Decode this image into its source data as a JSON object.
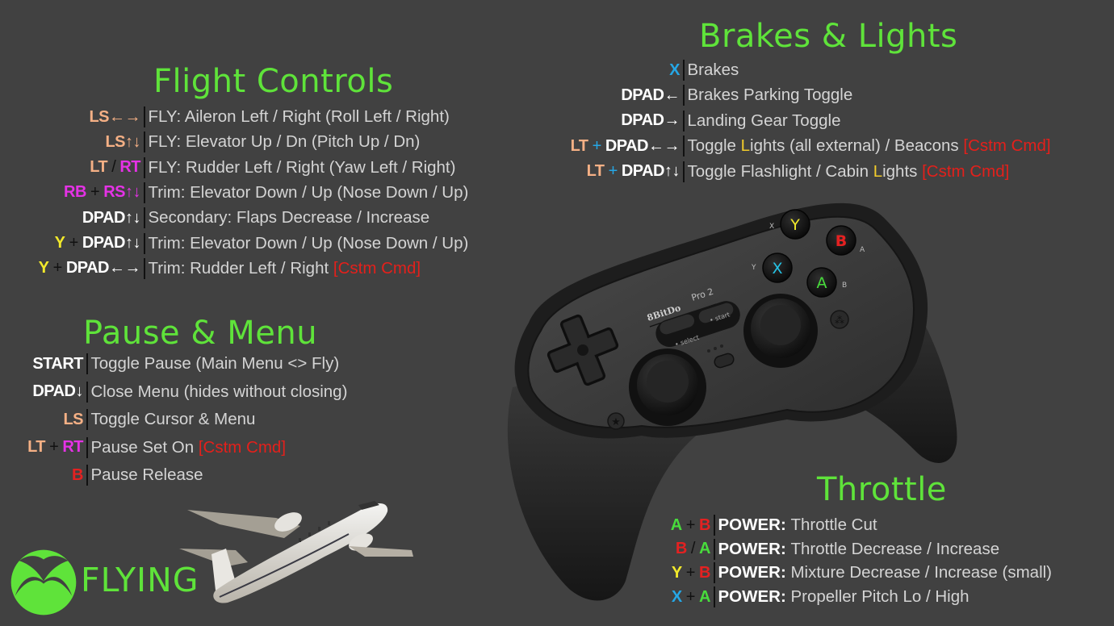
{
  "colors": {
    "background": "#414141",
    "title": "#5fe33a",
    "description": "#d4d4d4",
    "custom_command": "#e3201b",
    "left_stick_trigger": "#f5b085",
    "right_bumper_trigger": "#e532e6",
    "button_y": "#f2e92b",
    "button_b": "#e42121",
    "button_a": "#48dc3c",
    "button_x": "#25a7e6"
  },
  "sections": {
    "flight_controls": {
      "title": "Flight Controls",
      "rows": [
        {
          "combo": [
            {
              "t": "LS←→",
              "c": "ls"
            }
          ],
          "desc": "FLY: Aileron Left / Right (Roll Left / Right)"
        },
        {
          "combo": [
            {
              "t": "LS↑↓",
              "c": "ls"
            }
          ],
          "desc": "FLY: Elevator Up / Dn (Pitch Up / Dn)"
        },
        {
          "combo": [
            {
              "t": "LT",
              "c": "ls"
            },
            {
              "t": " / ",
              "c": "dark"
            },
            {
              "t": "RT",
              "c": "rt"
            }
          ],
          "desc": "FLY: Rudder Left / Right (Yaw Left / Right)"
        },
        {
          "combo": [
            {
              "t": "RB",
              "c": "rt"
            },
            {
              "t": " + ",
              "c": "dark"
            },
            {
              "t": "RS↑↓",
              "c": "rt"
            }
          ],
          "desc": "Trim: Elevator Down / Up (Nose Down / Up)"
        },
        {
          "combo": [
            {
              "t": "DPAD↑↓",
              "c": "w"
            }
          ],
          "desc": "Secondary: Flaps Decrease / Increase"
        },
        {
          "combo": [
            {
              "t": "Y",
              "c": "y"
            },
            {
              "t": " + ",
              "c": "dark"
            },
            {
              "t": "DPAD↑↓",
              "c": "w"
            }
          ],
          "desc": "Trim: Elevator Down / Up (Nose Down / Up)"
        },
        {
          "combo": [
            {
              "t": "Y",
              "c": "y"
            },
            {
              "t": " + ",
              "c": "dark"
            },
            {
              "t": "DPAD←→",
              "c": "w"
            }
          ],
          "desc": "Trim: Rudder Left / Right",
          "tag": "[Cstm Cmd]"
        }
      ]
    },
    "pause_menu": {
      "title": "Pause & Menu",
      "rows": [
        {
          "combo": [
            {
              "t": "START",
              "c": "w"
            }
          ],
          "desc": "Toggle Pause (Main Menu <> Fly)"
        },
        {
          "combo": [
            {
              "t": "DPAD↓",
              "c": "w"
            }
          ],
          "desc": "Close Menu (hides without closing)"
        },
        {
          "combo": [
            {
              "t": "LS",
              "c": "ls"
            }
          ],
          "desc": "Toggle Cursor & Menu"
        },
        {
          "combo": [
            {
              "t": "LT",
              "c": "ls"
            },
            {
              "t": " + ",
              "c": "dark"
            },
            {
              "t": "RT",
              "c": "rt"
            }
          ],
          "desc": "Pause Set On",
          "tag": "[Cstm Cmd]"
        },
        {
          "combo": [
            {
              "t": "B",
              "c": "b"
            }
          ],
          "desc": "Pause Release"
        }
      ]
    },
    "brakes_lights": {
      "title": "Brakes & Lights",
      "rows": [
        {
          "combo": [
            {
              "t": "X",
              "c": "x"
            }
          ],
          "desc": "Brakes"
        },
        {
          "combo": [
            {
              "t": "DPAD←",
              "c": "w"
            }
          ],
          "desc": "Brakes Parking Toggle"
        },
        {
          "combo": [
            {
              "t": "DPAD→",
              "c": "w"
            }
          ],
          "desc": "Landing Gear Toggle"
        },
        {
          "combo": [
            {
              "t": "LT",
              "c": "ls"
            },
            {
              "t": " + ",
              "c": "blueplus"
            },
            {
              "t": "DPAD←→",
              "c": "w"
            }
          ],
          "desc_parts": [
            "Toggle ",
            "L",
            "ights (all external) / Beacons"
          ],
          "tag": "[Cstm Cmd]"
        },
        {
          "combo": [
            {
              "t": "LT",
              "c": "ls"
            },
            {
              "t": " + ",
              "c": "blueplus"
            },
            {
              "t": "DPAD↑↓",
              "c": "w"
            }
          ],
          "desc_parts": [
            "Toggle Flashlight / Cabin ",
            "L",
            "ights"
          ],
          "tag": "[Cstm Cmd]"
        }
      ]
    },
    "throttle": {
      "title": "Throttle",
      "prefix": "POWER:",
      "rows": [
        {
          "combo": [
            {
              "t": "A",
              "c": "a"
            },
            {
              "t": " + ",
              "c": "dark"
            },
            {
              "t": "B",
              "c": "b"
            }
          ],
          "desc": "Throttle Cut"
        },
        {
          "combo": [
            {
              "t": "B",
              "c": "b"
            },
            {
              "t": " / ",
              "c": "dark"
            },
            {
              "t": "A",
              "c": "a"
            }
          ],
          "desc": "Throttle Decrease / Increase"
        },
        {
          "combo": [
            {
              "t": "Y",
              "c": "y"
            },
            {
              "t": " + ",
              "c": "dark"
            },
            {
              "t": "B",
              "c": "b"
            }
          ],
          "desc": "Mixture Decrease / Increase (small)"
        },
        {
          "combo": [
            {
              "t": "X",
              "c": "x"
            },
            {
              "t": " + ",
              "c": "dark"
            },
            {
              "t": "A",
              "c": "a"
            }
          ],
          "desc": "Propeller Pitch Lo / High"
        }
      ]
    }
  },
  "controller": {
    "brand": "8BitDo",
    "model": "Pro 2",
    "select_label": "• select",
    "start_label": "• start",
    "face_buttons": {
      "y": "Y",
      "b": "B",
      "x": "X",
      "a": "A"
    },
    "face_alt_labels": {
      "x": "X",
      "a": "A",
      "y": "Y",
      "b": "B"
    }
  },
  "branding": {
    "logo_icon": "xbox-logo-icon",
    "text": "FLYING"
  }
}
